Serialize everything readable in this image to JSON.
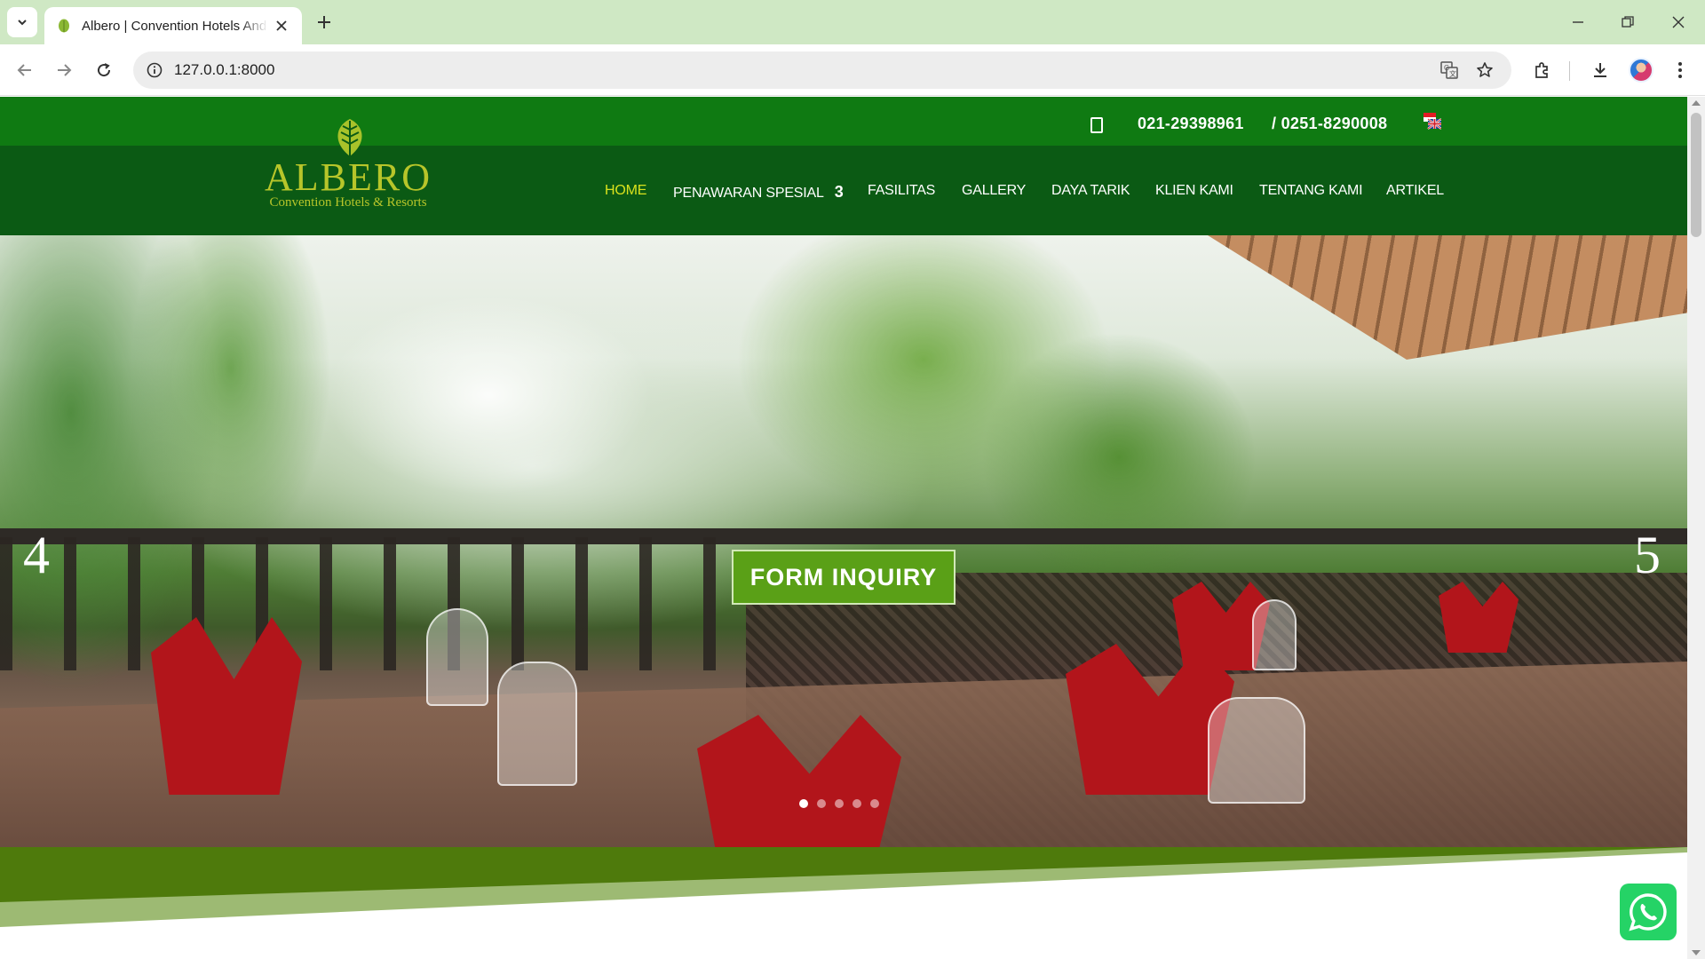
{
  "browser": {
    "tab_title": "Albero | Convention Hotels And Resorts",
    "url": "127.0.0.1:8000",
    "accent": "#cfe8c4"
  },
  "site": {
    "topbar": {
      "phone1": "021-29398961",
      "phone2": "/ 0251-8290008"
    },
    "logo": {
      "name": "ALBERO",
      "tagline": "Convention Hotels & Resorts"
    },
    "menu": [
      {
        "label": "HOME",
        "active": true
      },
      {
        "label": "PENAWARAN SPESIAL",
        "badge": "3"
      },
      {
        "label": "FASILITAS"
      },
      {
        "label": "GALLERY"
      },
      {
        "label": "DAYA TARIK"
      },
      {
        "label": "KLIEN KAMI"
      },
      {
        "label": "TENTANG KAMI"
      },
      {
        "label": "ARTIKEL"
      }
    ],
    "hero": {
      "prev_arrow": "4",
      "next_arrow": "5",
      "cta": "FORM INQUIRY",
      "slide_count": 5,
      "active_slide": 1
    },
    "colors": {
      "topbar": "#0f7a12",
      "navbar": "#0b5a14",
      "logo": "#b7c52a",
      "menu_active": "#d8e11d",
      "cta": "#5aa017",
      "whatsapp": "#25d366"
    }
  }
}
